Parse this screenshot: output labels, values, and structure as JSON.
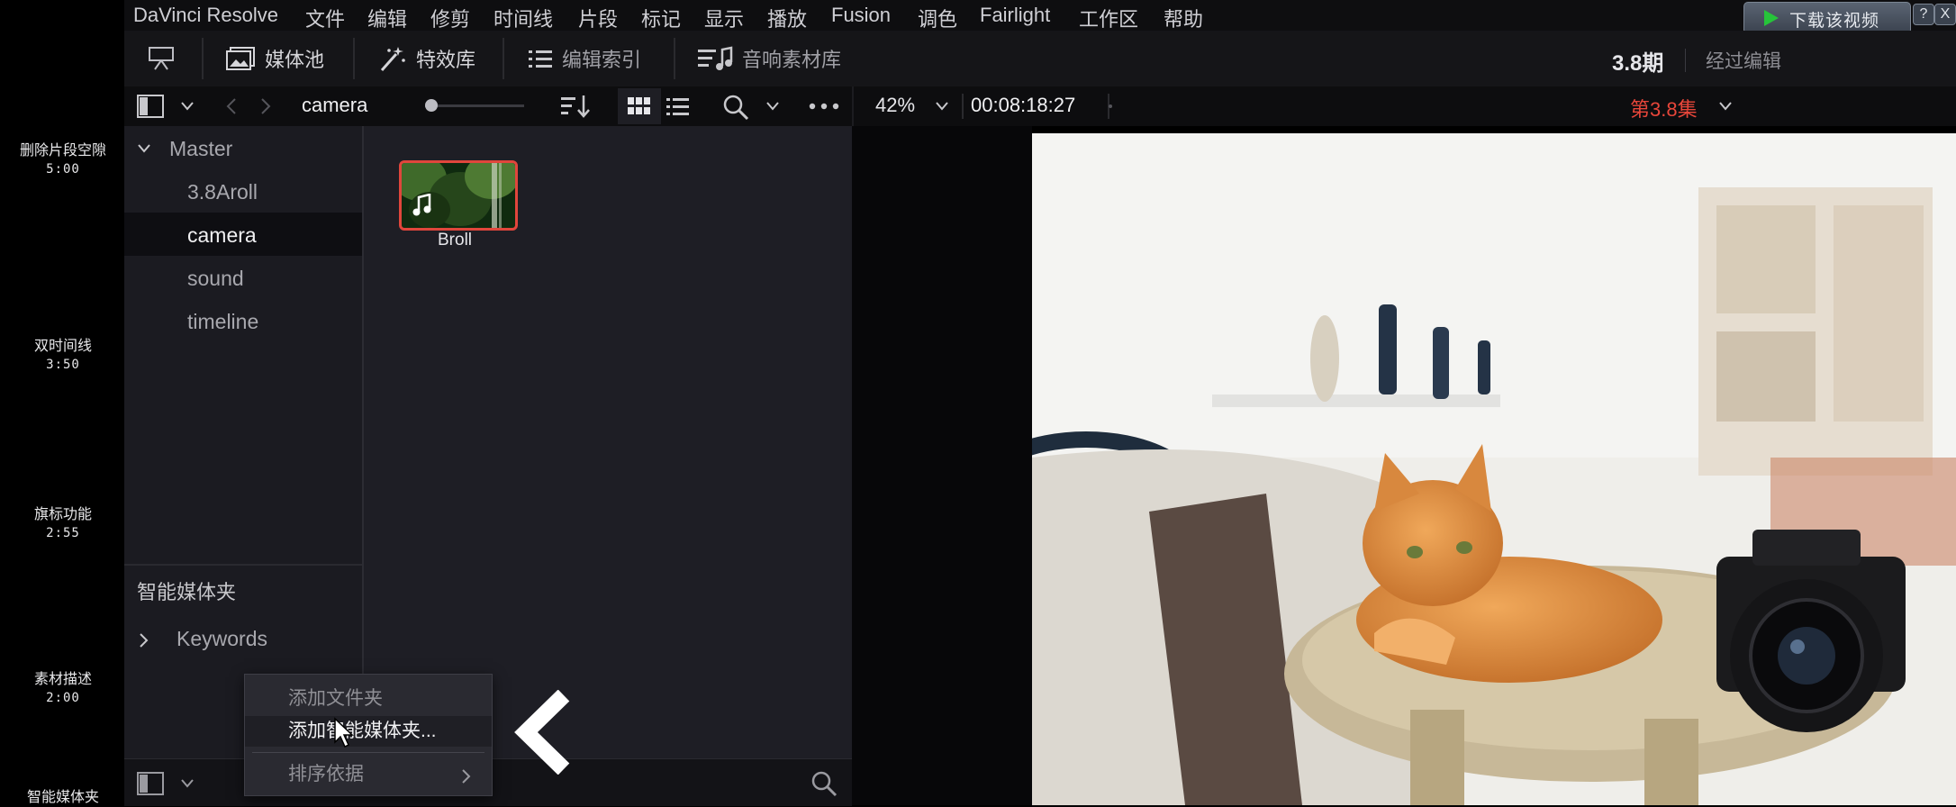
{
  "chapters": [
    {
      "title": "删除片段空隙",
      "time": "5:00"
    },
    {
      "title": "双时间线",
      "time": "3:50"
    },
    {
      "title": "旗标功能",
      "time": "2:55"
    },
    {
      "title": "素材描述",
      "time": "2:00"
    },
    {
      "title": "智能媒体夹",
      "time": ""
    }
  ],
  "menubar": {
    "items": [
      "DaVinci Resolve",
      "文件",
      "编辑",
      "修剪",
      "时间线",
      "片段",
      "标记",
      "显示",
      "播放",
      "Fusion",
      "调色",
      "Fairlight",
      "工作区",
      "帮助"
    ],
    "download_label": "下载该视频",
    "restore_label": "?",
    "close_label": "X"
  },
  "toolbar": {
    "media_pool": "媒体池",
    "effects": "特效库",
    "edit_index": "编辑索引",
    "sound_library": "音响素材库",
    "project_title": "3.8期",
    "project_sub": "经过编辑"
  },
  "bar2": {
    "bin_name": "camera",
    "zoom": "42%",
    "timecode": "00:08:18:27",
    "episode": "第3.8集"
  },
  "bins": {
    "master": "Master",
    "items": [
      "3.8Aroll",
      "camera",
      "sound",
      "timeline"
    ],
    "selected": "camera"
  },
  "smart_bins": {
    "title": "智能媒体夹",
    "keywords": "Keywords"
  },
  "clip": {
    "name": "Broll"
  },
  "context_menu": {
    "items": [
      "添加文件夹",
      "添加智能媒体夹...",
      "排序依据"
    ]
  },
  "colors": {
    "accent_red": "#e0463c",
    "episode_red": "#e8463a",
    "panel": "#1b1b21"
  }
}
